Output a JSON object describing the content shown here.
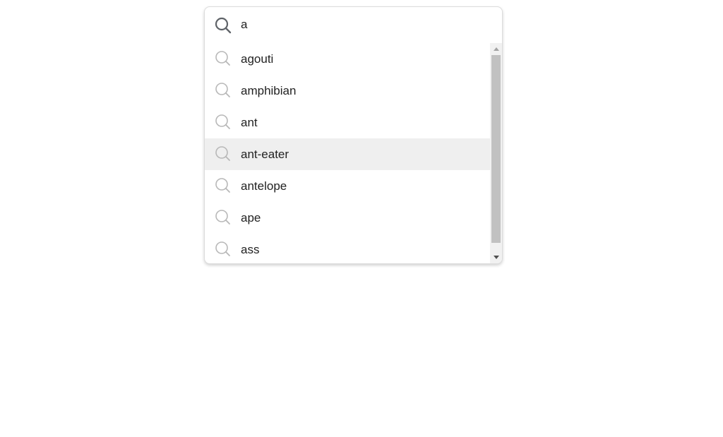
{
  "search": {
    "value": "a",
    "icon": "search-icon"
  },
  "suggestions": {
    "icon": "search-icon",
    "hovered_index": 3,
    "items": [
      {
        "label": "agouti"
      },
      {
        "label": "amphibian"
      },
      {
        "label": "ant"
      },
      {
        "label": "ant-eater"
      },
      {
        "label": "antelope"
      },
      {
        "label": "ape"
      },
      {
        "label": "ass"
      }
    ]
  },
  "colors": {
    "hover_background": "#efefef",
    "text": "#222222",
    "input_icon": "#5f6368",
    "suggestion_icon": "#b8b8b8"
  }
}
